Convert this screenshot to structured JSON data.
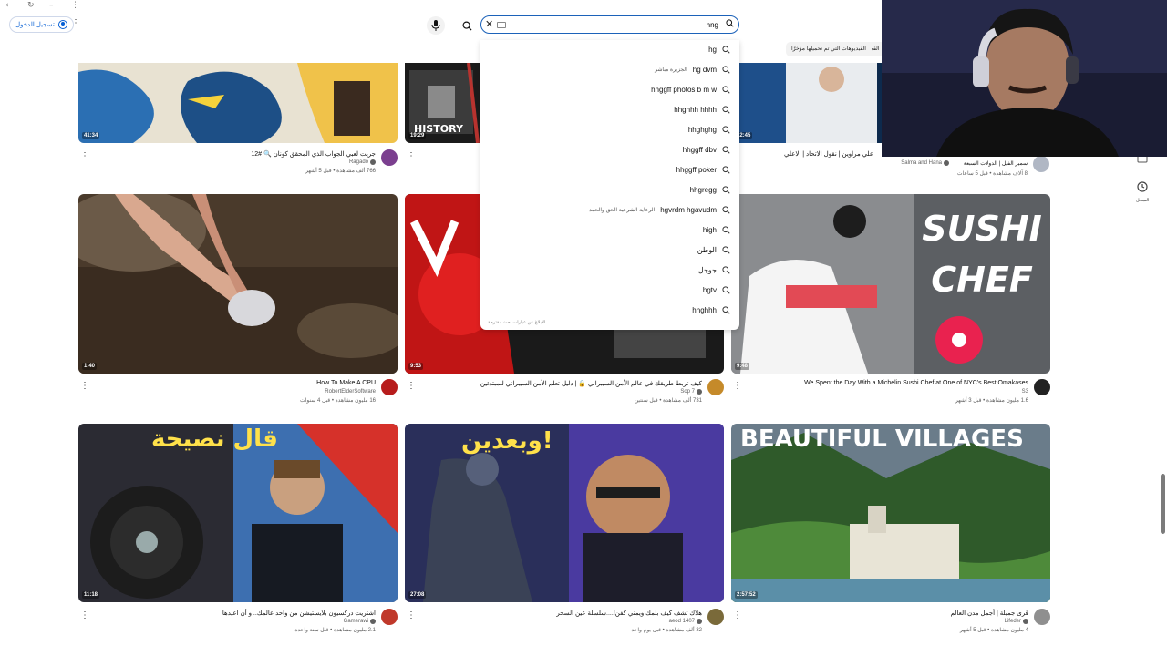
{
  "window": {
    "back": "‹",
    "refresh": "↻",
    "minimize": "–",
    "menu": "⋮"
  },
  "header": {
    "signin_label": "تسجيل الدخول",
    "search_query": "hng",
    "clear_icon": "close-icon",
    "mic_icon": "mic-icon",
    "search_icon": "search-icon"
  },
  "suggestions": {
    "items": [
      {
        "text": "hg",
        "extra": ""
      },
      {
        "text": "hg dvm",
        "extra": "الجزيرة مباشر"
      },
      {
        "text": "hhggff photos b m w",
        "extra": ""
      },
      {
        "text": "hhghhh hhhh",
        "extra": ""
      },
      {
        "text": "hhghghg",
        "extra": ""
      },
      {
        "text": "hhggff dbv",
        "extra": ""
      },
      {
        "text": "hhggff poker",
        "extra": ""
      },
      {
        "text": "hhgregg",
        "extra": ""
      },
      {
        "text": "hgvrdm hgavudm",
        "extra": "الرعاية الشرعية الحق والحمد"
      },
      {
        "text": "high",
        "extra": ""
      },
      {
        "text": "الوطن",
        "extra": ""
      },
      {
        "text": "جوجل",
        "extra": ""
      },
      {
        "text": "hgtv",
        "extra": ""
      },
      {
        "text": "hhghhh",
        "extra": ""
      }
    ],
    "footer": "الإبلاغ عن عبارات بحث مقترحة"
  },
  "chips": [
    {
      "label": "القم"
    },
    {
      "label": "الفيديوهات التي تم تحميلها مؤخرًا"
    }
  ],
  "sidebar": {
    "subs_label": "اشتراكات",
    "history_label": "السجل"
  },
  "videos": [
    {
      "duration": "41:34",
      "title": "جريت لعبي الجواب الذي المحقق كونان 🔍 #12",
      "channel": "Ragado",
      "verified": true,
      "stats": "766 ألف مشاهدة • قبل 5 أشهر",
      "thumb_text": ""
    },
    {
      "duration": "19:29",
      "title": "",
      "channel": "",
      "verified": false,
      "stats": "",
      "thumb_text": "HISTORY"
    },
    {
      "duration": "12:45",
      "title": "علي مراوين | نقول الاتحاد | الاعلي",
      "channel": "",
      "verified": false,
      "stats": "",
      "thumb_text": ""
    },
    {
      "duration": "",
      "title": "سمير الفيل | الدولات السبعة",
      "channel": "Salma and Hana",
      "verified": true,
      "stats": "8 آلاف مشاهدة • قبل 5 ساعات",
      "thumb_text": ""
    },
    {
      "duration": "1:40",
      "title": "How To Make A CPU",
      "channel": "RobertElderSoftware",
      "verified": false,
      "stats": "16 مليون مشاهدة • قبل 4 سنوات",
      "thumb_text": ""
    },
    {
      "duration": "9:53",
      "title": "كيف تربط طريقك في عالم الأمن السيبراني 🔒 | دليل تعلم الأمن السيبراني للمبتدئين",
      "channel": "Sop 7",
      "verified": true,
      "stats": "731 ألف مشاهدة • قبل سنتين",
      "thumb_text": ""
    },
    {
      "duration": "9:48",
      "title": "We Spent the Day With a Michelin Sushi Chef at One of NYC's Best Omakases",
      "channel": "S3",
      "verified": false,
      "stats": "1.6 مليون مشاهدة • قبل 3 أشهر",
      "thumb_text": "SUSHI CHEF"
    },
    {
      "duration": "11:18",
      "title": "اشتريت دركسيون بلايستيشن من واحد عالمك.. و أن اعيدها",
      "channel": "Gamerawi",
      "verified": true,
      "stats": "2.1 مليون مشاهدة • قبل سنة واحدة",
      "thumb_text": "قال نصيحة"
    },
    {
      "duration": "27:08",
      "title": "هلاك تشف كيف بلمك ويمني كفن!....سلسلة عين السحر",
      "channel": "aeod 1407",
      "verified": true,
      "stats": "32 ألف مشاهدة • قبل يوم واحد",
      "thumb_text": "وبعدين!"
    },
    {
      "duration": "2:57:52",
      "title": "قرى جميلة | أجمل مدن العالم",
      "channel": "Lifeder",
      "verified": true,
      "stats": "4 مليون مشاهدة • قبل 5 أشهر",
      "thumb_text": "BEAUTIFUL VILLAGES"
    }
  ]
}
